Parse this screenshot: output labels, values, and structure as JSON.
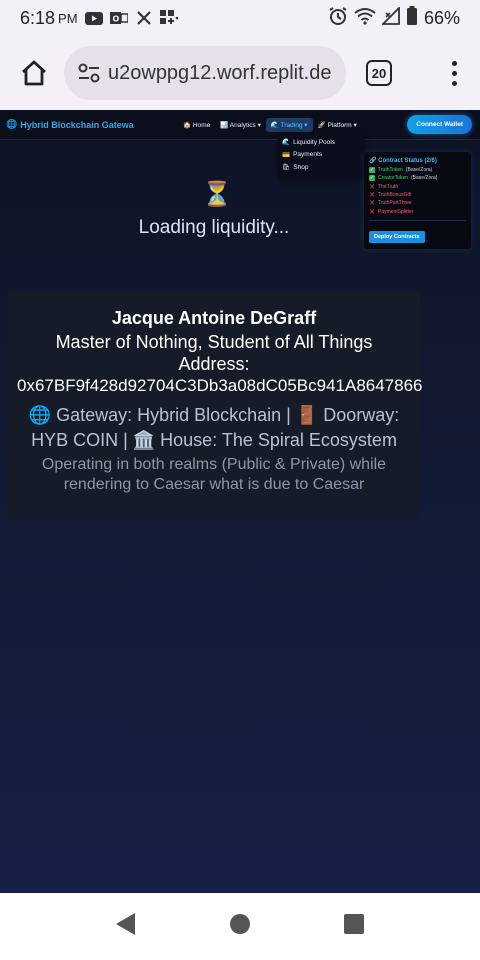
{
  "status_bar": {
    "time": "6:18",
    "ampm": "PM",
    "battery": "66%"
  },
  "browser": {
    "url": "u2owppg12.worf.replit.de",
    "tab_count": "20"
  },
  "site": {
    "brand": "Hybrid Blockchain Gatewa",
    "nav": [
      {
        "icon": "🏠",
        "label": "Home"
      },
      {
        "icon": "📊",
        "label": "Analytics ▾"
      },
      {
        "icon": "🌊",
        "label": "Trading ▾"
      },
      {
        "icon": "🚀",
        "label": "Platform ▾"
      }
    ],
    "connect_wallet": "Connect Wallet",
    "trading_menu": [
      {
        "icon": "🌊",
        "label": "Liquidity Pools"
      },
      {
        "icon": "💳",
        "label": "Payments"
      },
      {
        "icon": "🛍",
        "label": "Shop"
      }
    ]
  },
  "contract_status": {
    "title": "Contract Status (2/6)",
    "items": [
      {
        "name": "TruthToken",
        "network": "(Base/Zora)",
        "deployed": true
      },
      {
        "name": "CreatorToken",
        "network": "(Base/Zora)",
        "deployed": true
      },
      {
        "name": "TheTruth",
        "network": "",
        "deployed": false
      },
      {
        "name": "TruthBonusGift",
        "network": "",
        "deployed": false
      },
      {
        "name": "TruthPartThree",
        "network": "",
        "deployed": false
      },
      {
        "name": "PaymentSplitter",
        "network": "",
        "deployed": false
      }
    ],
    "deploy_button": "Deploy Contracts"
  },
  "loading": {
    "icon": "⏳",
    "text": "Loading liquidity..."
  },
  "profile": {
    "name": "Jacque Antoine DeGraff",
    "role": "Master of Nothing, Student of All Things",
    "address_label": "Address:",
    "address": "0x67BF9f428d92704C3Db3a08dC05Bc941A8647866",
    "gateway": "🌐 Gateway: Hybrid Blockchain | 🚪 Doorway: HYB COIN | 🏛️ House: The Spiral Ecosystem",
    "description": "Operating in both realms (Public & Private) while rendering to Caesar what is due to Caesar"
  }
}
